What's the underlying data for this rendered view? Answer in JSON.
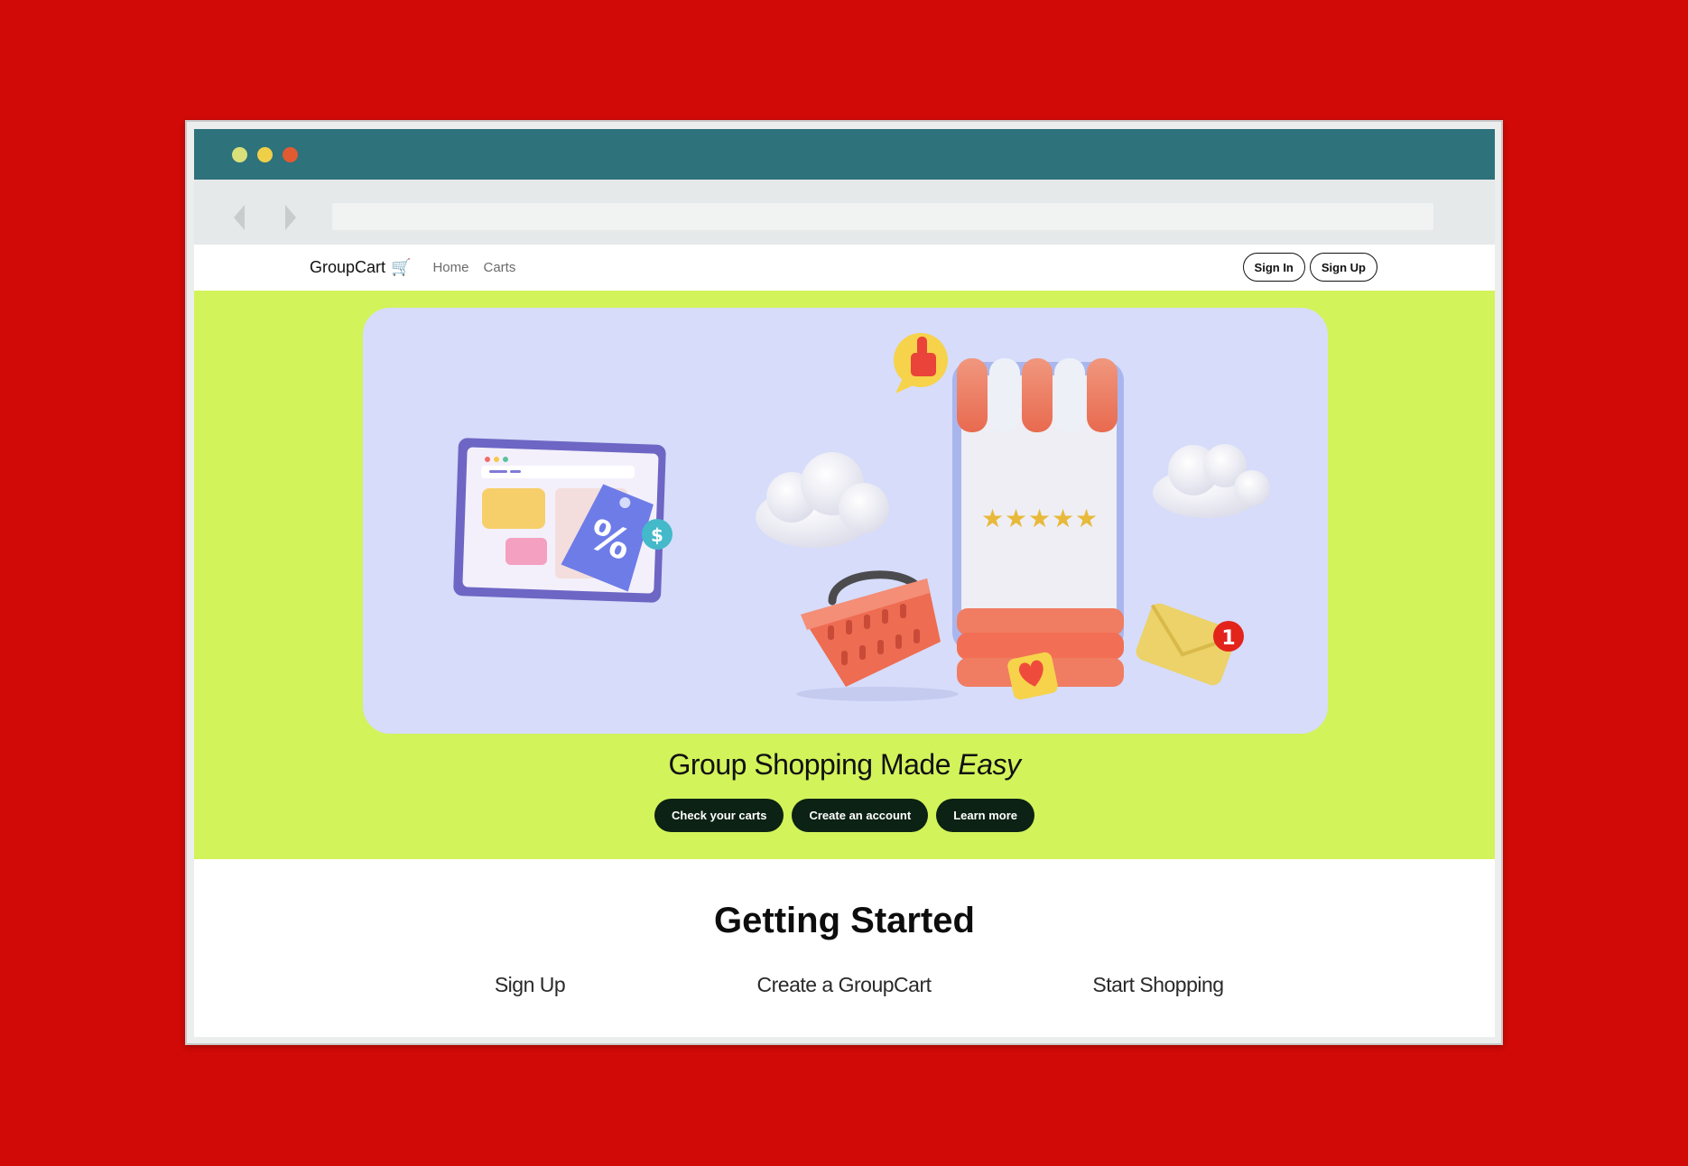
{
  "browser": {
    "dots": [
      "#d9e07a",
      "#f0cf48",
      "#e05a32"
    ]
  },
  "nav": {
    "brand": "GroupCart",
    "brand_icon": "🛒",
    "links": [
      "Home",
      "Carts"
    ],
    "sign_in": "Sign In",
    "sign_up": "Sign Up"
  },
  "hero": {
    "title_main": "Group Shopping Made ",
    "title_em": "Easy",
    "buttons": [
      "Check your carts",
      "Create an account",
      "Learn more"
    ],
    "illustration": {
      "notification_count": "1",
      "rating_stars": 5,
      "price_tag_symbol": "%",
      "coin_symbol": "$"
    }
  },
  "getting_started": {
    "title": "Getting Started",
    "steps": [
      "Sign Up",
      "Create a GroupCart",
      "Start Shopping"
    ]
  },
  "colors": {
    "page_bg": "#d10a07",
    "hero_bg": "#d2f35a",
    "card_bg": "#d6dcfa",
    "titlebar": "#2e727c",
    "dark_button": "#0c2214"
  }
}
